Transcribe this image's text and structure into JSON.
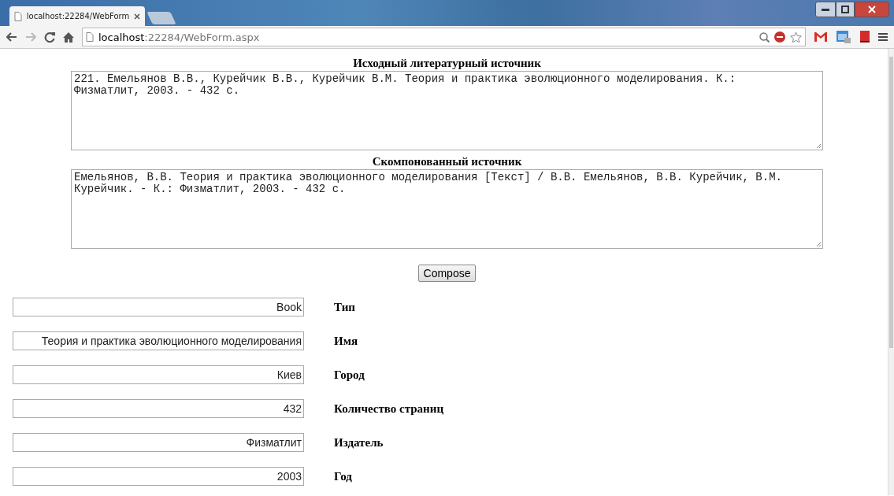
{
  "browser": {
    "tab_title": "localhost:22284/WebForm",
    "address": {
      "host": "localhost",
      "rest": ":22284/WebForm.aspx"
    }
  },
  "page": {
    "source_heading": "Исходный литературный источник",
    "source_text": "221. Емельянов В.В., Курейчик В.В., Курейчик В.М. Теория и практика эволюционного моделирования. К.: Физматлит, 2003. - 432 с.",
    "composed_heading": "Скомпонованный источник",
    "composed_text": "Емельянов, В.В. Теория и практика эволюционного моделирования [Текст] / В.В. Емельянов, В.В. Курейчик, В.М. Курейчик. - К.: Физматлит, 2003. - 432 с.",
    "compose_button": "Compose",
    "fields": [
      {
        "value": "Book",
        "label": "Тип"
      },
      {
        "value": "Теория и практика эволюционного моделирования",
        "label": "Имя"
      },
      {
        "value": "Киев",
        "label": "Город"
      },
      {
        "value": "432",
        "label": "Количество страниц"
      },
      {
        "value": "Физматлит",
        "label": "Издатель"
      },
      {
        "value": "2003",
        "label": "Год"
      }
    ]
  }
}
